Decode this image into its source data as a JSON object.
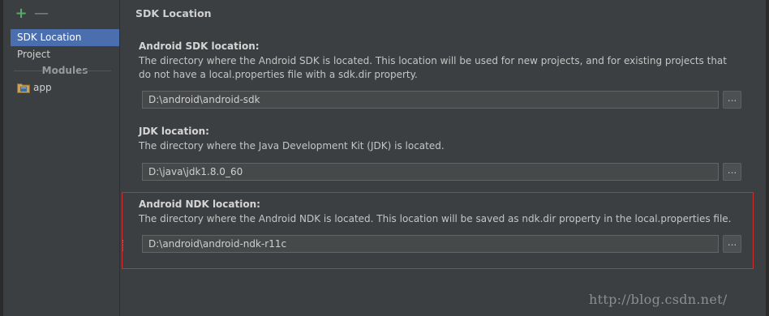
{
  "toolbar": {
    "add_icon": "plus-icon",
    "remove_icon": "minus-icon",
    "add_glyph": "+",
    "remove_glyph": "—"
  },
  "nav": {
    "items": [
      {
        "label": "SDK Location",
        "selected": true
      },
      {
        "label": "Project",
        "selected": false
      }
    ],
    "modules_heading": "Modules",
    "modules": [
      {
        "label": "app",
        "icon": "module-folder-icon"
      }
    ]
  },
  "page": {
    "title": "SDK Location"
  },
  "sections": {
    "sdk": {
      "title": "Android SDK location:",
      "description": "The directory where the Android SDK is located. This location will be used for new projects, and for existing projects that do not have a local.properties file with a sdk.dir property.",
      "path": "D:\\android\\android-sdk",
      "browse_label": "..."
    },
    "jdk": {
      "title": "JDK location:",
      "description": "The directory where the Java Development Kit (JDK) is located.",
      "path": "D:\\java\\jdk1.8.0_60",
      "browse_label": "..."
    },
    "ndk": {
      "title": "Android NDK location:",
      "description": "The directory where the Android NDK is located. This location will be saved as ndk.dir property in the local.properties file.",
      "path": "D:\\android\\android-ndk-r11c",
      "browse_label": "..."
    }
  },
  "watermark": "http://blog.csdn.net/",
  "colors": {
    "background": "#3c3f41",
    "selection": "#4b6eaf",
    "highlight_border": "#d02e2e",
    "add_icon": "#59a869"
  }
}
